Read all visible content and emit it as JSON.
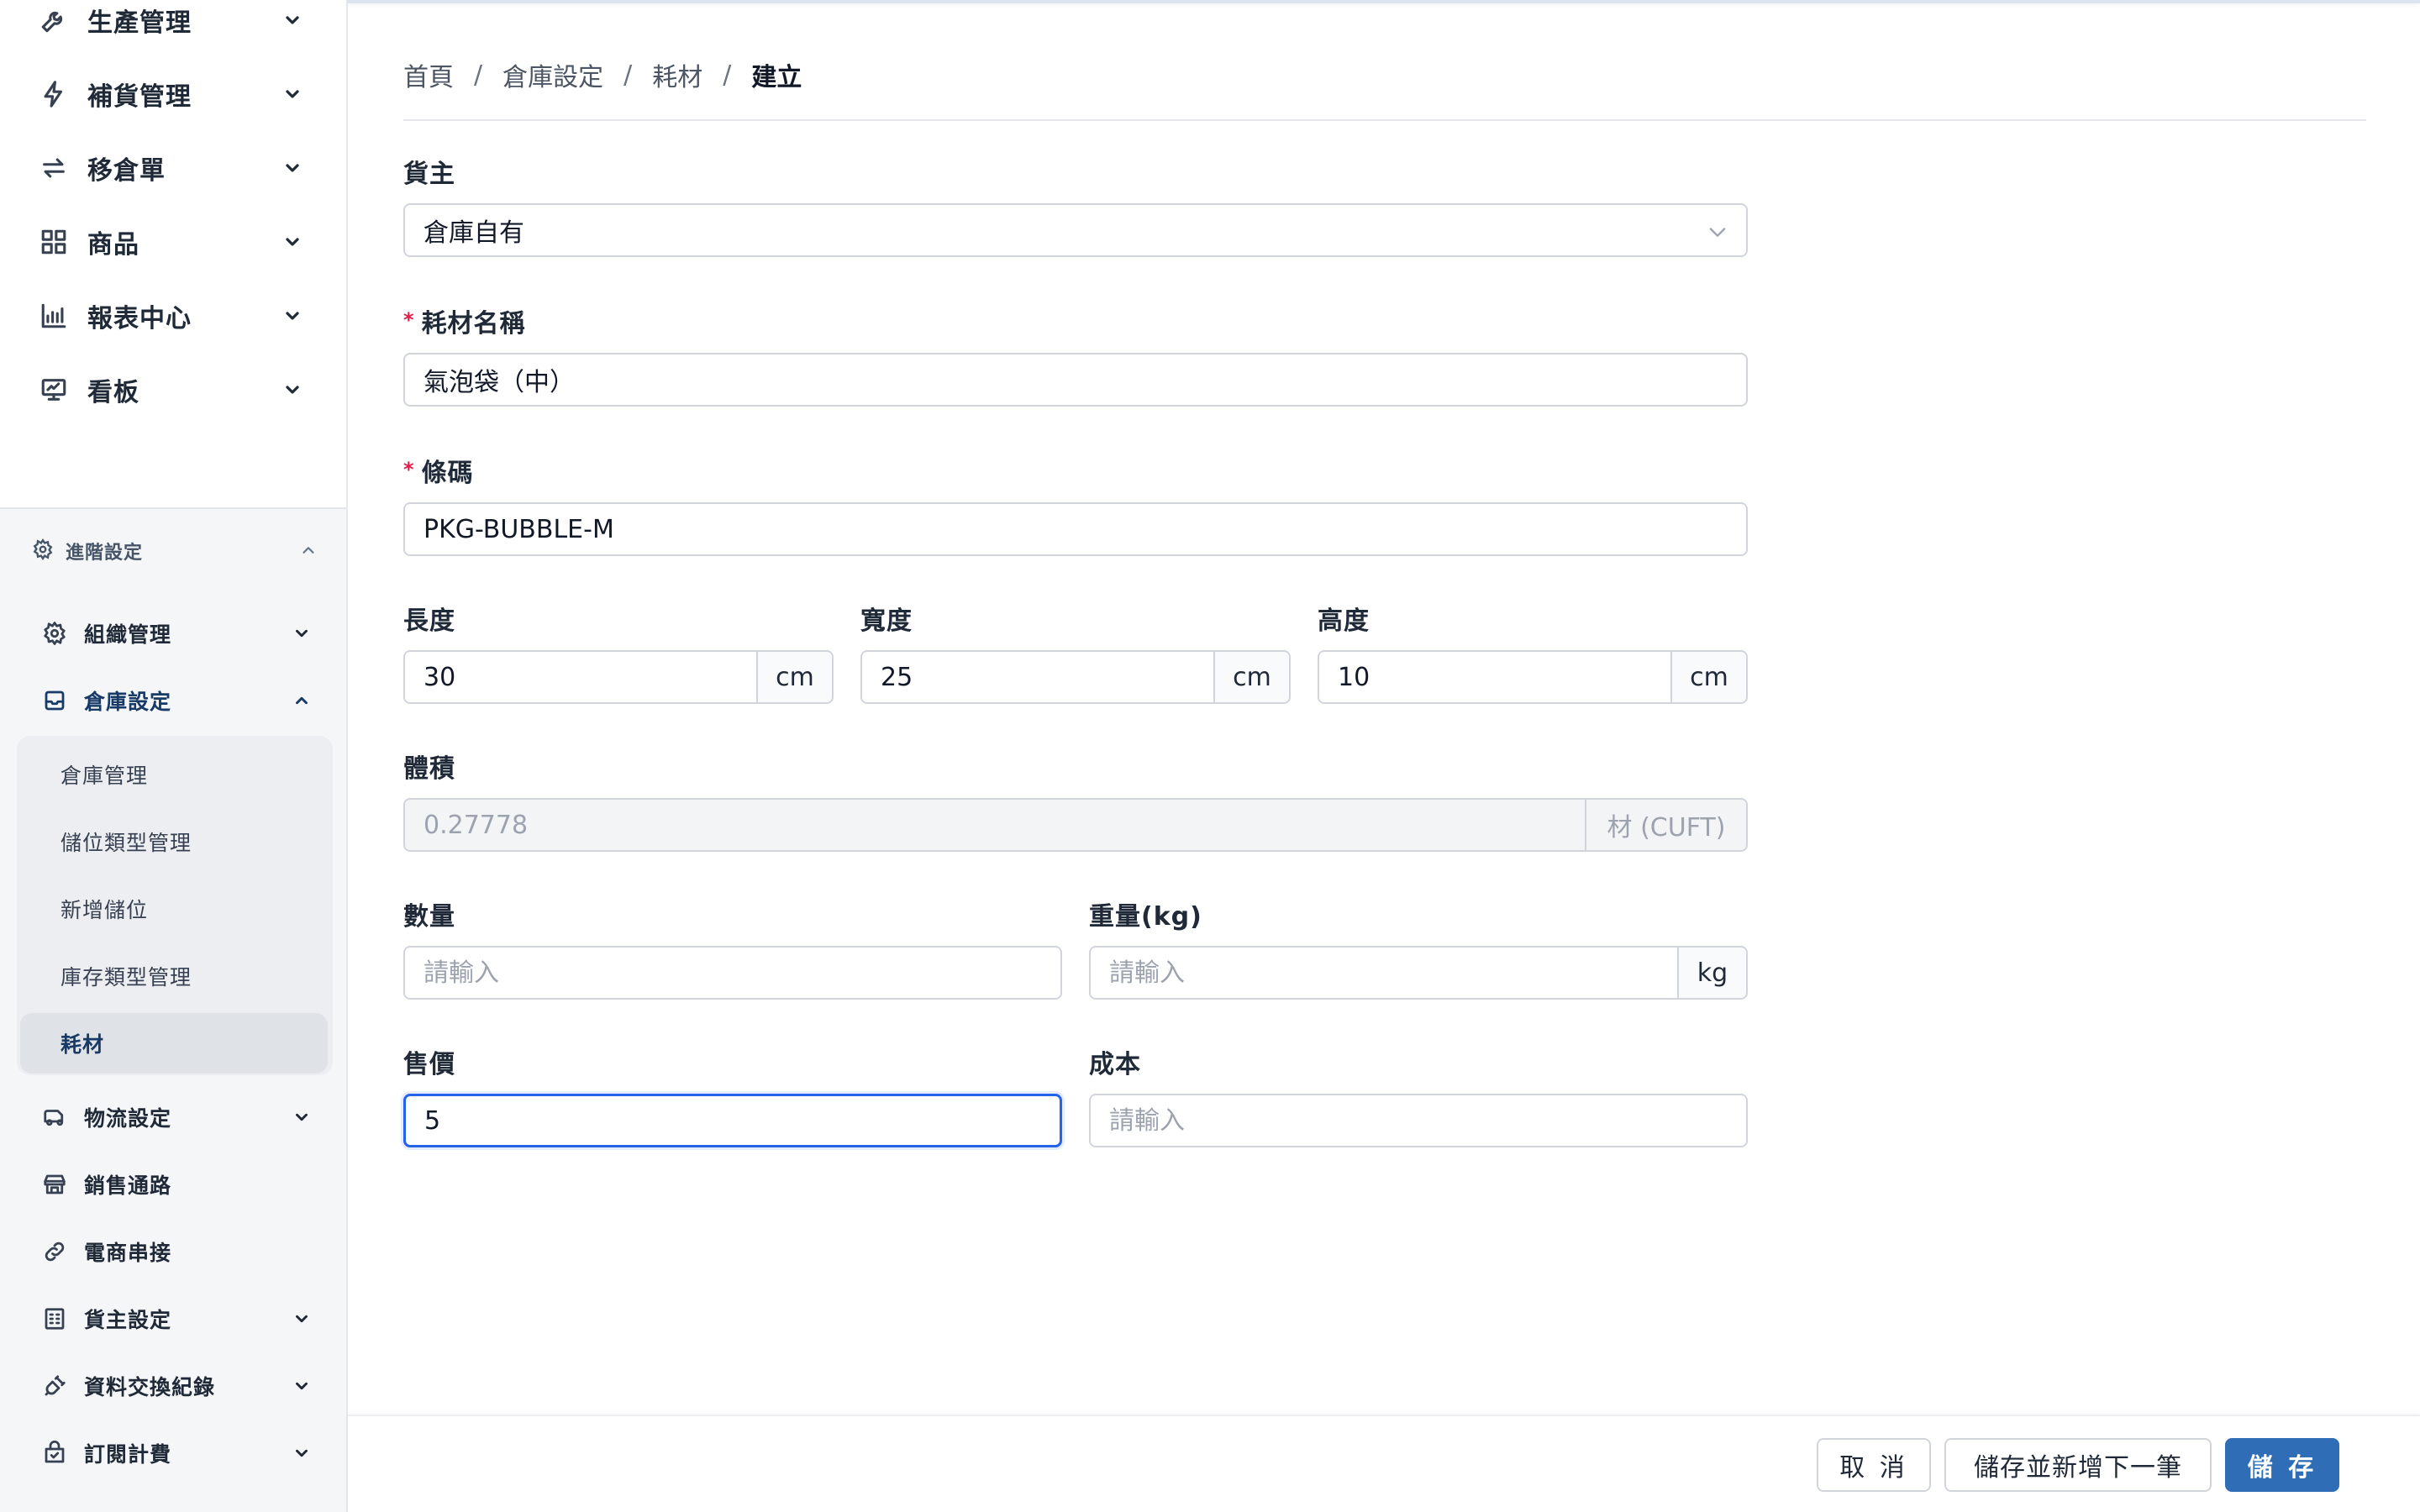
{
  "sidebar": {
    "top_items": [
      {
        "label": "生產管理",
        "icon": "wrench-icon"
      },
      {
        "label": "補貨管理",
        "icon": "lightning-icon"
      },
      {
        "label": "移倉單",
        "icon": "transfer-icon"
      },
      {
        "label": "商品",
        "icon": "grid-icon"
      },
      {
        "label": "報表中心",
        "icon": "bar-chart-icon"
      },
      {
        "label": "看板",
        "icon": "dashboard-icon"
      }
    ],
    "advanced_title": "進階設定",
    "advanced_items": {
      "org": "組織管理",
      "warehouse": "倉庫設定",
      "logistics": "物流設定",
      "channels": "銷售通路",
      "ecommerce": "電商串接",
      "owner": "貨主設定",
      "data_exchange": "資料交換紀錄",
      "billing": "訂閱計費"
    },
    "warehouse_children": [
      "倉庫管理",
      "儲位類型管理",
      "新增儲位",
      "庫存類型管理",
      "耗材"
    ]
  },
  "breadcrumb": {
    "items": [
      "首頁",
      "倉庫設定",
      "耗材"
    ],
    "current": "建立",
    "separator": "/"
  },
  "form": {
    "owner": {
      "label": "貨主",
      "value": "倉庫自有"
    },
    "name": {
      "label": "耗材名稱",
      "value": "氣泡袋（中）",
      "required": "*"
    },
    "barcode": {
      "label": "條碼",
      "value": "PKG-BUBBLE-M",
      "required": "*"
    },
    "length": {
      "label": "長度",
      "value": "30",
      "unit": "cm"
    },
    "width": {
      "label": "寬度",
      "value": "25",
      "unit": "cm"
    },
    "height": {
      "label": "高度",
      "value": "10",
      "unit": "cm"
    },
    "volume": {
      "label": "體積",
      "value": "0.27778",
      "unit": "材 (CUFT)"
    },
    "quantity": {
      "label": "數量",
      "placeholder": "請輸入"
    },
    "weight": {
      "label": "重量(kg)",
      "placeholder": "請輸入",
      "unit": "kg"
    },
    "price": {
      "label": "售價",
      "value": "5"
    },
    "cost": {
      "label": "成本",
      "placeholder": "請輸入"
    }
  },
  "footer": {
    "cancel": "取 消",
    "save_next": "儲存並新增下一筆",
    "save": "儲 存"
  },
  "colors": {
    "primary": "#2f6eb6",
    "active_text": "#173a67",
    "required": "#e11d48",
    "focus_border": "#2563eb"
  }
}
